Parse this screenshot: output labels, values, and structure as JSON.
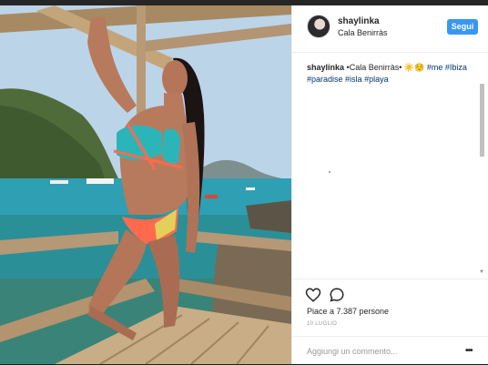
{
  "post": {
    "username": "shaylinka",
    "location": "Cala Benirràs",
    "follow_label": "Segui",
    "caption_user": "shaylinka",
    "caption_text": "•Cala Benirràs• ☀️☺️",
    "hashtags": [
      "#me",
      "#Ibiza",
      "#paradise",
      "#isla",
      "#playa"
    ],
    "likes": "Piace a 7.387 persone",
    "date": "10 LUGLIO",
    "comment_placeholder": "Aggiungi un commento...",
    "more_label": "•••"
  },
  "icons": {
    "like": "heart-icon",
    "comment": "comment-icon",
    "more": "more-options-icon"
  },
  "colors": {
    "follow_button": "#3897f0",
    "hashtag": "#003569"
  }
}
